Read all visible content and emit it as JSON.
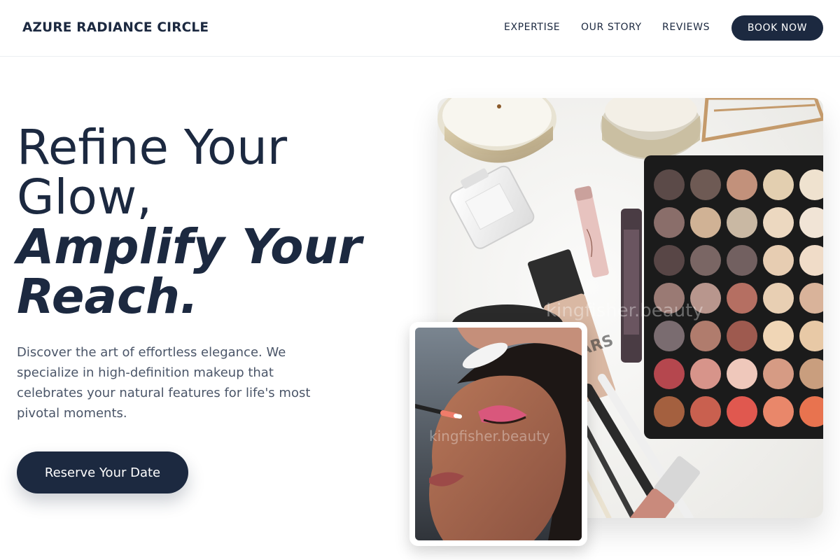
{
  "header": {
    "brand": "AZURE RADIANCE CIRCLE",
    "nav": [
      "EXPERTISE",
      "OUR STORY",
      "REVIEWS"
    ],
    "cta": "BOOK NOW"
  },
  "hero": {
    "title_line1": "Refine Your",
    "title_line2": "Glow,",
    "title_line3": "Amplify Your",
    "title_line4": "Reach.",
    "description": "Discover the art of effortless elegance. We specialize in high-definition makeup that celebrates your natural features for life's most pivotal moments.",
    "cta": "Reserve Your Date"
  },
  "images": {
    "main_watermark": "kingfisher.beauty",
    "inset_watermark": "kingfisher.beauty"
  },
  "colors": {
    "primary": "#1c2940",
    "body_text": "#4a5568",
    "background": "#ffffff"
  }
}
